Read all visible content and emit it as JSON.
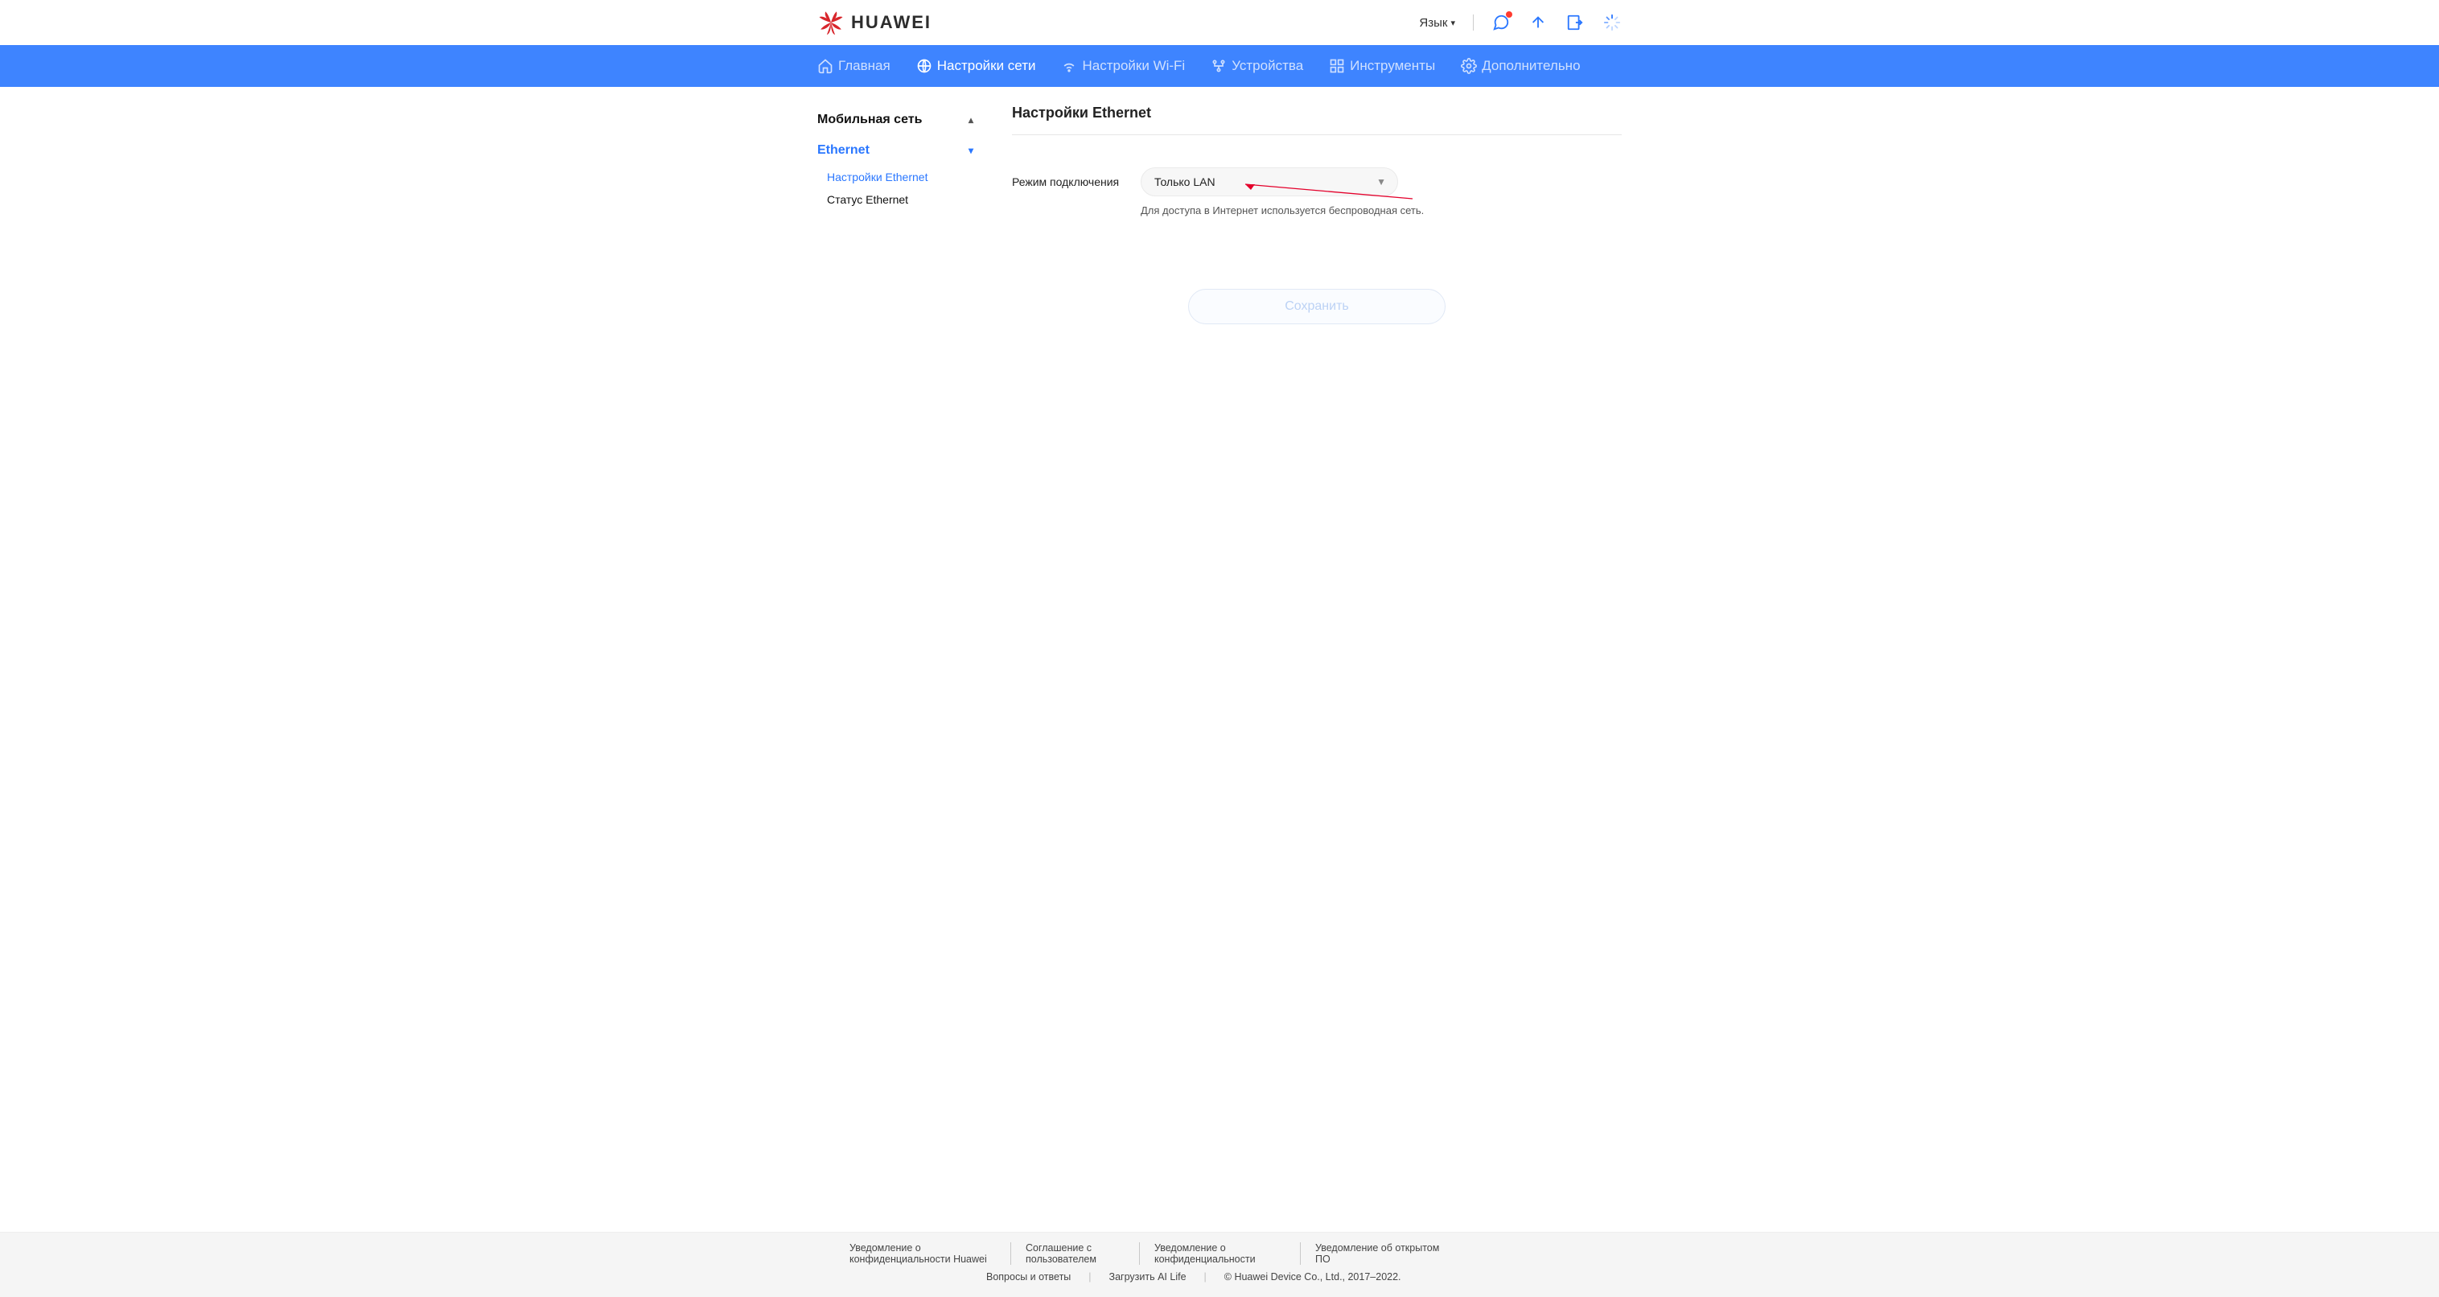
{
  "header": {
    "brand": "HUAWEI",
    "language_label": "Язык"
  },
  "nav": {
    "home": "Главная",
    "network": "Настройки сети",
    "wifi": "Настройки Wi-Fi",
    "devices": "Устройства",
    "tools": "Инструменты",
    "advanced": "Дополнительно"
  },
  "sidebar": {
    "mobile_group": "Мобильная сеть",
    "ethernet_group": "Ethernet",
    "eth_settings": "Настройки Ethernet",
    "eth_status": "Статус Ethernet"
  },
  "main": {
    "title": "Настройки Ethernet",
    "mode_label": "Режим подключения",
    "mode_value": "Только LAN",
    "help": "Для доступа в Интернет используется беспроводная сеть.",
    "save": "Сохранить"
  },
  "footer": {
    "privacy_huawei": "Уведомление о конфиденциальности Huawei",
    "user_agreement": "Соглашение с пользователем",
    "privacy_notice": "Уведомление о конфиденциальности",
    "open_source": "Уведомление об открытом ПО",
    "faq": "Вопросы и ответы",
    "download_app": "Загрузить AI Life",
    "copyright": "© Huawei Device Co., Ltd., 2017–2022."
  }
}
